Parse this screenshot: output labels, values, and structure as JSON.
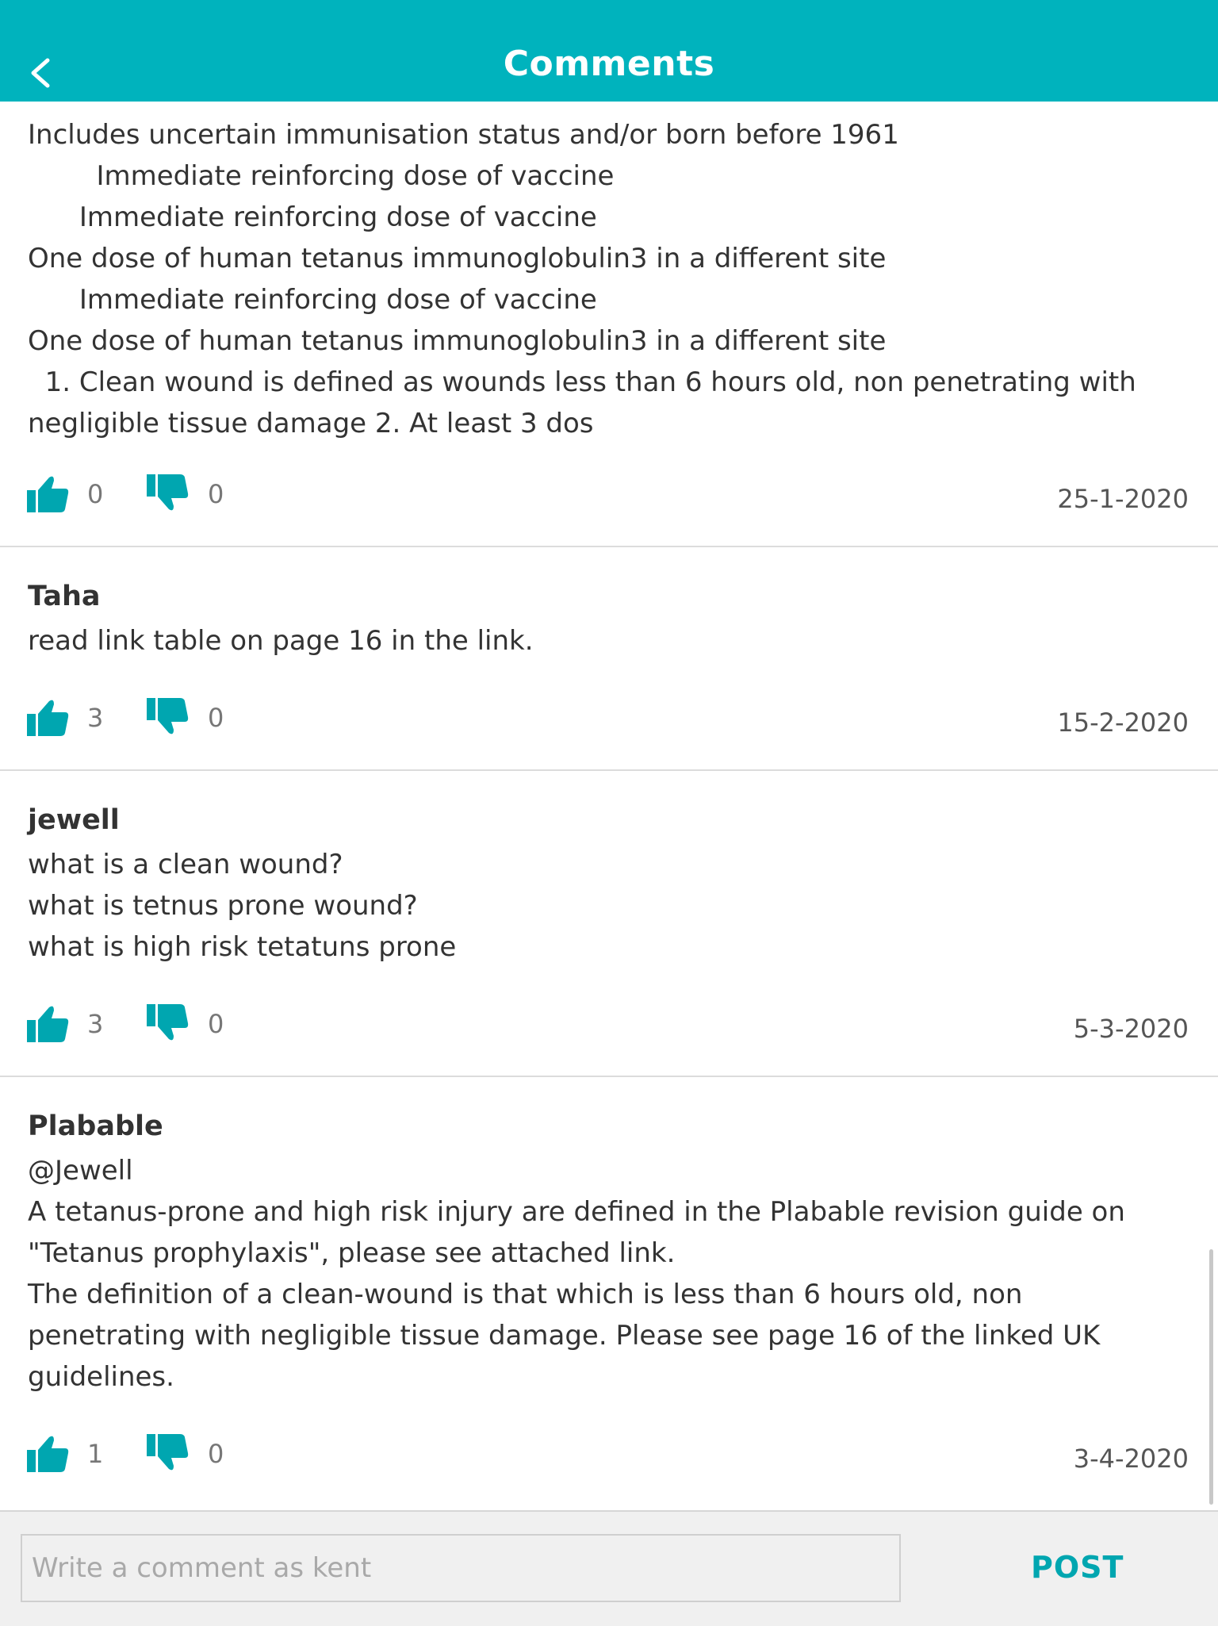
{
  "header": {
    "title": "Comments",
    "back_icon": "chevron-left-icon"
  },
  "comments": [
    {
      "author": "",
      "lines": [
        "Includes uncertain immunisation status and/or born before 1961",
        "        Immediate reinforcing dose of vaccine",
        "      Immediate reinforcing dose of vaccine",
        "One dose of human tetanus immunoglobulin3 in a different site",
        "      Immediate reinforcing dose of vaccine",
        "One dose of human tetanus immunoglobulin3 in a different site",
        "  1. Clean wound is defined as wounds less than 6 hours old, non penetrating with",
        "negligible tissue damage 2. At least 3 dos"
      ],
      "likes": "0",
      "dislikes": "0",
      "date": "25-1-2020"
    },
    {
      "author": "Taha",
      "lines": [
        "read link table on page 16 in the link."
      ],
      "likes": "3",
      "dislikes": "0",
      "date": "15-2-2020"
    },
    {
      "author": "jewell",
      "lines": [
        "what is a clean wound?",
        "what is tetnus prone wound?",
        "what is high risk tetatuns prone"
      ],
      "likes": "3",
      "dislikes": "0",
      "date": "5-3-2020"
    },
    {
      "author": "Plabable",
      "lines": [
        "@Jewell",
        "A tetanus-prone and high risk injury are defined in the Plabable revision guide on",
        "\"Tetanus prophylaxis\", please see attached link.",
        "The definition of a clean-wound is that which is less than 6 hours old, non",
        "penetrating with negligible tissue damage. Please see page 16 of the linked UK",
        "guidelines."
      ],
      "likes": "1",
      "dislikes": "0",
      "date": "3-4-2020"
    }
  ],
  "composer": {
    "placeholder": "Write a comment as kent",
    "post_label": "POST"
  },
  "colors": {
    "accent": "#00b3bd",
    "icon": "#00a6b0"
  }
}
